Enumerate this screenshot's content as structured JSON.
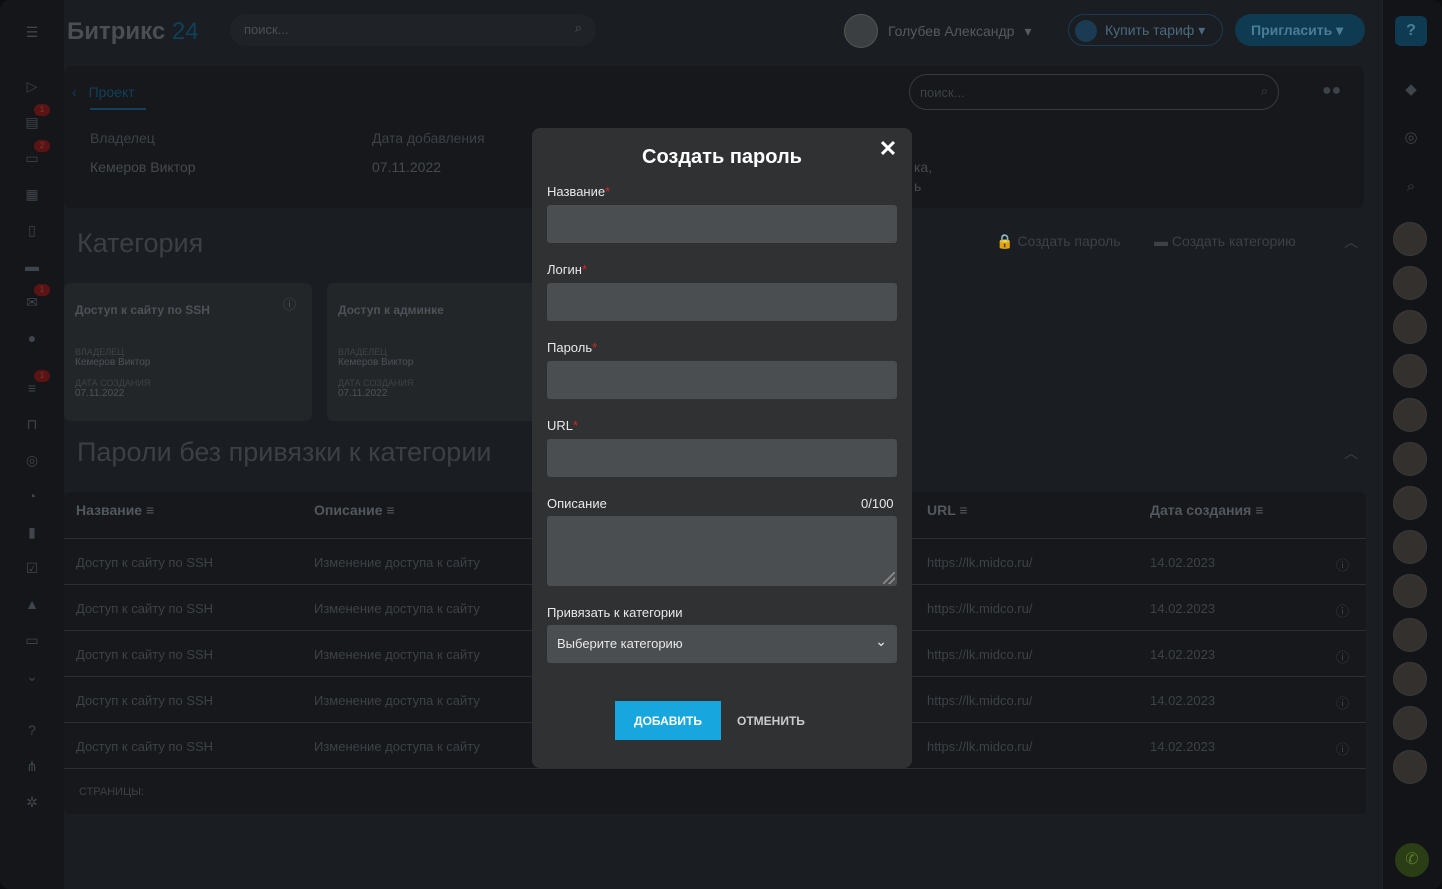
{
  "topbar": {
    "logo_text": "Битрикс",
    "logo_num": "24",
    "search_placeholder": "поиск...",
    "user_name": "Голубев Александр",
    "buy_tariff": "Купить тариф",
    "invite": "Пригласить"
  },
  "left_counters": [
    "1",
    "2",
    "1",
    "1"
  ],
  "project": {
    "breadcrumb": "Проект",
    "owner_label": "Владелец",
    "owner_value": "Кемеров Виктор",
    "date_label": "Дата добавления",
    "date_value": "07.11.2022",
    "side_text_1": "ка,",
    "side_text_2": "ь",
    "search_placeholder": "поиск..."
  },
  "category_section": {
    "title": "Категория",
    "create_password": "Создать пароль",
    "create_category": "Создать категорию"
  },
  "cards": [
    {
      "title": "Доступ к сайту по SSH",
      "owner_label": "ВЛАДЕЛЕЦ",
      "owner": "Кемеров Виктор",
      "date_label": "ДАТА СОЗДАНИЯ",
      "date": "07.11.2022"
    },
    {
      "title": "Доступ к админке",
      "owner_label": "ВЛАДЕЛЕЦ",
      "owner": "Кемеров Виктор",
      "date_label": "ДАТА СОЗДАНИЯ",
      "date": "07.11.2022"
    }
  ],
  "uncat_title": "Пароли без привязки к категории",
  "table": {
    "headers": [
      "Название",
      "Описание",
      "URL",
      "Дата создания"
    ],
    "rows": [
      {
        "name": "Доступ к сайту по SSH",
        "desc": "Изменение доступа к сайту",
        "url": "https://lk.midco.ru/",
        "date": "14.02.2023"
      },
      {
        "name": "Доступ к сайту по SSH",
        "desc": "Изменение доступа к сайту",
        "url": "https://lk.midco.ru/",
        "date": "14.02.2023"
      },
      {
        "name": "Доступ к сайту по SSH",
        "desc": "Изменение доступа к сайту",
        "url": "https://lk.midco.ru/",
        "date": "14.02.2023"
      },
      {
        "name": "Доступ к сайту по SSH",
        "desc": "Изменение доступа к сайту",
        "url": "https://lk.midco.ru/",
        "date": "14.02.2023"
      },
      {
        "name": "Доступ к сайту по SSH",
        "desc": "Изменение доступа к сайту",
        "url": "https://lk.midco.ru/",
        "date": "14.02.2023"
      }
    ],
    "pages_label": "СТРАНИЦЫ:"
  },
  "modal": {
    "title": "Создать пароль",
    "name_label": "Название",
    "login_label": "Логин",
    "password_label": "Пароль",
    "url_label": "URL",
    "desc_label": "Описание",
    "desc_counter": "0/100",
    "cat_label": "Привязать к категории",
    "cat_placeholder": "Выберите категорию",
    "add": "ДОБАВИТЬ",
    "cancel": "ОТМЕНИТЬ",
    "required_mark": "*"
  }
}
